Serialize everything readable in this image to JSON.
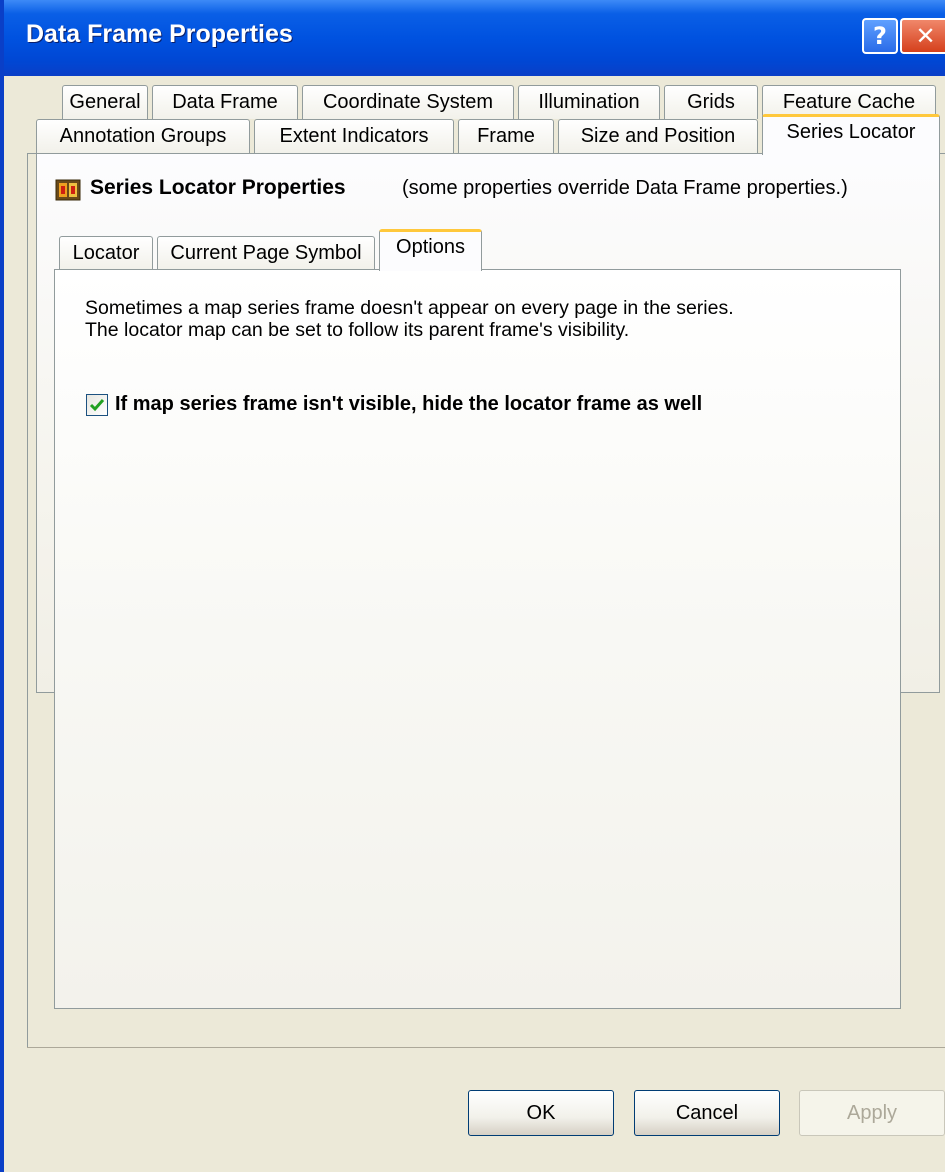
{
  "window": {
    "title": "Data Frame Properties",
    "help_glyph": "?",
    "close_glyph": "✕"
  },
  "tabs_row1": [
    "General",
    "Data Frame",
    "Coordinate System",
    "Illumination",
    "Grids",
    "Feature Cache"
  ],
  "tabs_row2": [
    "Annotation Groups",
    "Extent Indicators",
    "Frame",
    "Size and Position",
    "Series Locator"
  ],
  "selected_tab": "Series Locator",
  "section": {
    "title": "Series Locator Properties",
    "note": "(some properties override Data Frame properties.)"
  },
  "subtabs": [
    "Locator",
    "Current Page Symbol",
    "Options"
  ],
  "selected_subtab": "Options",
  "options": {
    "description_line1": "Sometimes a map series frame doesn't appear on every page in the series.",
    "description_line2": "The locator map can be set to follow its parent frame's visibility.",
    "hide_locator_label": "If map series frame isn't visible, hide the locator frame as well",
    "hide_locator_checked": true
  },
  "buttons": {
    "ok": "OK",
    "cancel": "Cancel",
    "apply": "Apply"
  },
  "colors": {
    "titlebar": "#0052e0",
    "selected_tab_accent": "#ffc83c",
    "checkmark": "#21a121"
  }
}
